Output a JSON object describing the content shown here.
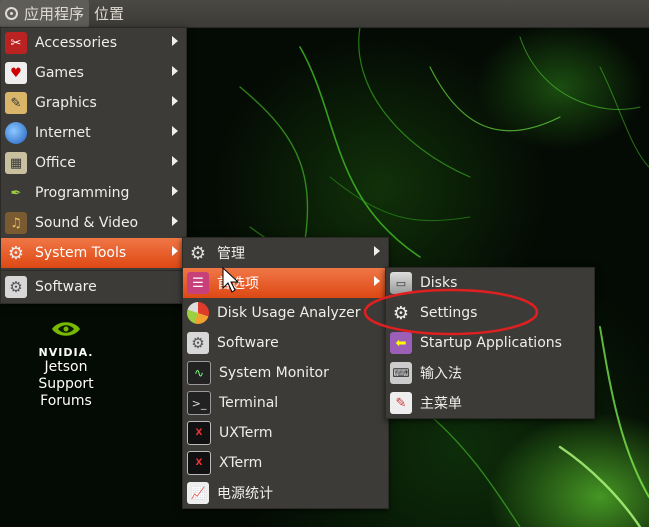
{
  "panel": {
    "applications_label": "应用程序",
    "places_label": "位置"
  },
  "main_menu": [
    {
      "label": "Accessories",
      "icon": "accessories-icon",
      "submenu": true
    },
    {
      "label": "Games",
      "icon": "games-icon",
      "submenu": true
    },
    {
      "label": "Graphics",
      "icon": "graphics-icon",
      "submenu": true
    },
    {
      "label": "Internet",
      "icon": "internet-icon",
      "submenu": true
    },
    {
      "label": "Office",
      "icon": "office-icon",
      "submenu": true
    },
    {
      "label": "Programming",
      "icon": "programming-icon",
      "submenu": true
    },
    {
      "label": "Sound & Video",
      "icon": "sound-video-icon",
      "submenu": true
    },
    {
      "label": "System Tools",
      "icon": "system-tools-icon",
      "submenu": true,
      "highlighted": true
    },
    {
      "label": "Software",
      "icon": "software-icon",
      "submenu": false
    }
  ],
  "system_tools_menu": [
    {
      "label": "管理",
      "icon": "administration-icon",
      "submenu": true
    },
    {
      "label": "首选项",
      "icon": "preferences-icon",
      "submenu": true,
      "highlighted": true
    },
    {
      "label": "Disk Usage Analyzer",
      "icon": "disk-usage-icon"
    },
    {
      "label": "Software",
      "icon": "software-icon"
    },
    {
      "label": "System Monitor",
      "icon": "system-monitor-icon"
    },
    {
      "label": "Terminal",
      "icon": "terminal-icon"
    },
    {
      "label": "UXTerm",
      "icon": "uxterm-icon"
    },
    {
      "label": "XTerm",
      "icon": "xterm-icon"
    },
    {
      "label": "电源统计",
      "icon": "power-statistics-icon"
    }
  ],
  "preferences_menu": [
    {
      "label": "Disks",
      "icon": "disks-icon"
    },
    {
      "label": "Settings",
      "icon": "settings-icon",
      "annotated": true
    },
    {
      "label": "Startup Applications",
      "icon": "startup-applications-icon"
    },
    {
      "label": "输入法",
      "icon": "keyboard-icon"
    },
    {
      "label": "主菜单",
      "icon": "main-menu-editor-icon"
    }
  ],
  "desktop_icon": {
    "brand": "NVIDIA.",
    "caption_lines": [
      "Jetson",
      "Support",
      "Forums"
    ]
  },
  "colors": {
    "highlight": "#dd4814",
    "menu_bg": "#3c3b37",
    "annotation": "#e02020"
  }
}
